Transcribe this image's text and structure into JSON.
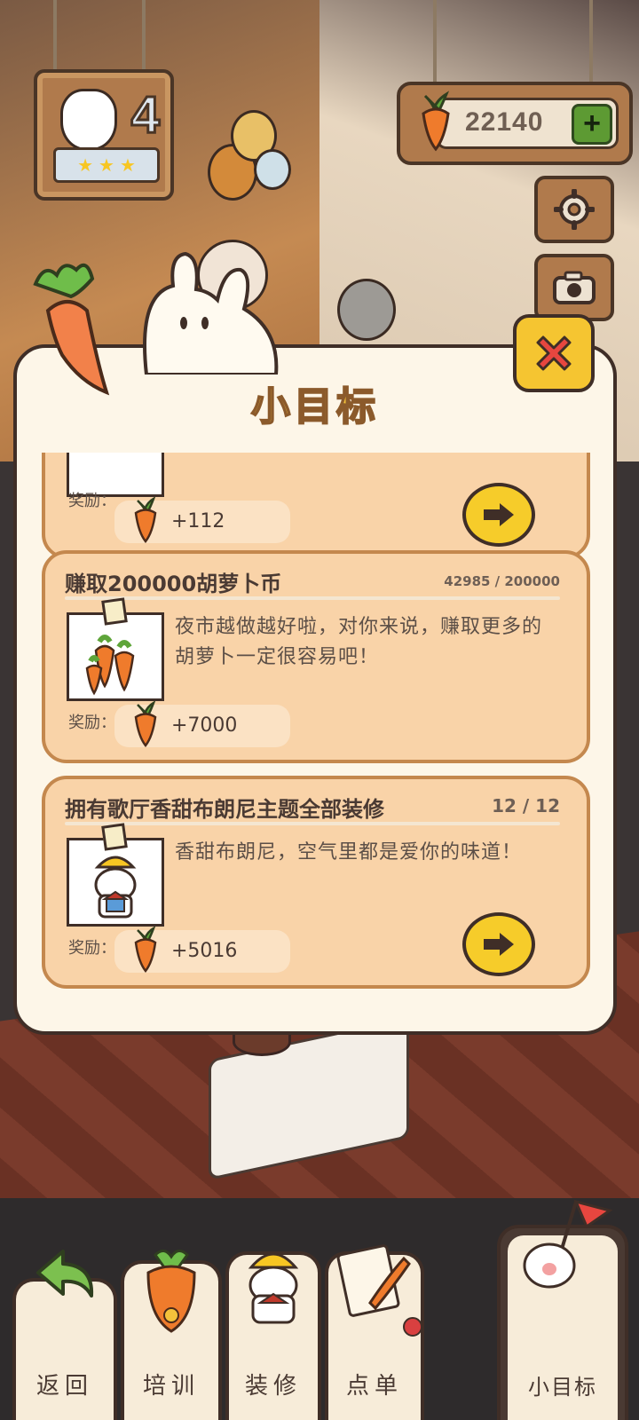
{
  "hud": {
    "level": "4",
    "carrot_coins": "22140",
    "add_label": "+"
  },
  "dialog": {
    "title": "小目标",
    "reward_label": "奖励：",
    "tasks": [
      {
        "title": "",
        "progress": "",
        "desc": "",
        "reward": "+112"
      },
      {
        "title": "赚取200000胡萝卜币",
        "progress": "42985 / 200000",
        "desc": "夜市越做越好啦，对你来说，赚取更多的胡萝卜一定很容易吧！",
        "reward": "+7000"
      },
      {
        "title": "拥有歌厅香甜布朗尼主题全部装修",
        "progress": "12 / 12",
        "desc": "香甜布朗尼，空气里都是爱你的味道！",
        "reward": "+5016"
      }
    ]
  },
  "nav": [
    {
      "label": "返回"
    },
    {
      "label": "培训"
    },
    {
      "label": "装修"
    },
    {
      "label": "点单"
    },
    {
      "label": "小目标"
    }
  ],
  "icons": {
    "settings": "gear-icon",
    "camera": "camera-icon",
    "close": "close-icon",
    "go": "arrow-right-icon",
    "back": "back-arrow-icon",
    "carrot": "carrot-icon"
  },
  "colors": {
    "card_bg": "#f9d3a8",
    "card_border": "#c4884e",
    "accent_yellow": "#f6cc2a",
    "dialog_bg": "#fdf6e8",
    "plus_green": "#5d9a33"
  }
}
